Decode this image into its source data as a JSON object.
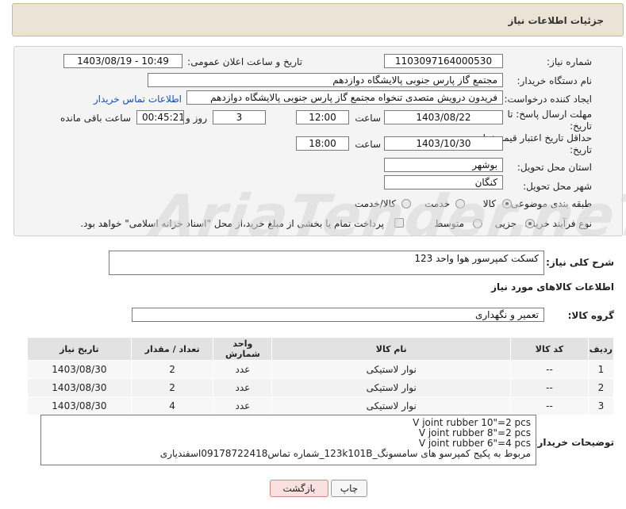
{
  "header": {
    "title": "جزئیات اطلاعات نیاز"
  },
  "form": {
    "need_number_label": "شماره نیاز:",
    "need_number": "1103097164000530",
    "announce_label": "تاریخ و ساعت اعلان عمومی:",
    "announce_value": "1403/08/19 - 10:49",
    "buyer_org_label": "نام دستگاه خریدار:",
    "buyer_org": "مجتمع گاز پارس جنوبی  پالایشگاه دوازدهم",
    "requester_label": "ایجاد کننده درخواست:",
    "requester": "فریدون درویش متصدی تنخواه مجتمع گاز پارس جنوبی  پالایشگاه دوازدهم",
    "contact_link": "اطلاعات تماس خریدار",
    "deadline_label": "مهلت ارسال پاسخ: تا تاریخ:",
    "deadline_date": "1403/08/22",
    "time_label": "ساعت",
    "deadline_time": "12:00",
    "days_count": "3",
    "days_label": "روز و",
    "remaining_time": "00:45:21",
    "remaining_label": "ساعت باقی مانده",
    "validity_label": "حداقل تاریخ اعتبار قیمت: تا تاریخ:",
    "validity_date": "1403/10/30",
    "validity_time": "18:00",
    "province_label": "استان محل تحویل:",
    "province": "بوشهر",
    "city_label": "شهر محل تحویل:",
    "city": "کنگان",
    "category_label": "طبقه بندی موضوعی:",
    "category_options": [
      "کالا",
      "خدمت",
      "کالا/خدمت"
    ],
    "process_label": "نوع فرآیند خرید :",
    "process_options": [
      "جزیی",
      "متوسط"
    ],
    "payment_note": "پرداخت تمام یا بخشی از مبلغ خرید،از محل \"اسناد خزانه اسلامی\" خواهد بود."
  },
  "summary": {
    "label": "شرح کلی نیاز:",
    "value": "کسکت کمپرسور هوا واحد 123"
  },
  "goods_section_title": "اطلاعات کالاهای مورد نیاز",
  "goods_group": {
    "label": "گروه کالا:",
    "value": "تعمیر و نگهداری"
  },
  "table": {
    "headers": [
      "ردیف",
      "کد کالا",
      "نام کالا",
      "واحد شمارش",
      "تعداد / مقدار",
      "تاریخ نیاز"
    ],
    "rows": [
      [
        "1",
        "--",
        "نوار لاستیکی",
        "عدد",
        "2",
        "1403/08/30"
      ],
      [
        "2",
        "--",
        "نوار لاستیکی",
        "عدد",
        "2",
        "1403/08/30"
      ],
      [
        "3",
        "--",
        "نوار لاستیکی",
        "عدد",
        "4",
        "1403/08/30"
      ]
    ]
  },
  "buyer_notes": {
    "label": "توضیحات خریدار:",
    "lines": [
      "V joint rubber 10\"=2 pcs",
      "V joint rubber 8\"=2 pcs",
      "V joint rubber 6\"=4 pcs",
      "مربوط به پکیج کمپرسو های سامسونگ_123k101B_شماره تماس09178722418اسفندیاری"
    ]
  },
  "buttons": {
    "back": "بازگشت",
    "print": "چاپ"
  },
  "watermark": "AriaTender.neT",
  "colors": {
    "header_bg": "#ebe4d6",
    "link": "#1a4fb8",
    "back_button_bg": "#fbe0e0"
  }
}
